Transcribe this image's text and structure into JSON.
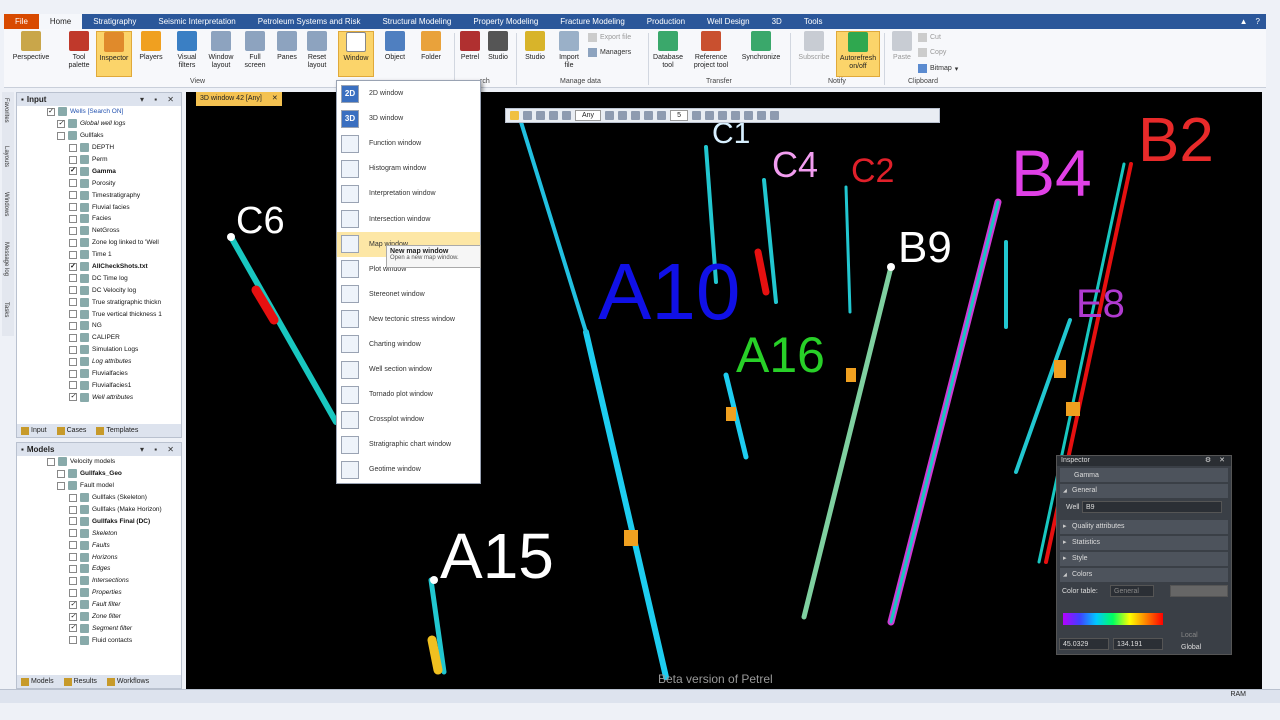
{
  "menu": {
    "file": "File",
    "tabs": [
      "Home",
      "Stratigraphy",
      "Seismic Interpretation",
      "Petroleum Systems and Risk",
      "Structural Modeling",
      "Property Modeling",
      "Fracture Modeling",
      "Production",
      "Well Design",
      "3D",
      "Tools"
    ]
  },
  "ribbon": {
    "perspective": "Perspective",
    "tool_palette": "Tool palette",
    "inspector": "Inspector",
    "players": "Players",
    "visual_filters": "Visual filters",
    "window_layout": "Window layout",
    "full_screen": "Full screen",
    "panes": "Panes",
    "reset_layout": "Reset layout",
    "window": "Window",
    "object": "Object",
    "folder": "Folder",
    "petrel": "Petrel",
    "studio_search": "Studio",
    "studio": "Studio",
    "import_file": "Import file",
    "export_file": "Export file",
    "managers": "Managers",
    "database_tool": "Database tool",
    "reference_project_tool": "Reference project tool",
    "synchronize": "Synchronize",
    "subscribe": "Subscribe",
    "autorefresh": "Autorefresh on/off",
    "paste": "Paste",
    "cut": "Cut",
    "copy": "Copy",
    "bitmap": "Bitmap",
    "group_view": "View",
    "group_search": "rch",
    "group_manage": "Manage data",
    "group_transfer": "Transfer",
    "group_notify": "Notify",
    "group_clipboard": "Clipboard"
  },
  "side_strip": [
    "Favorites",
    "Layouts",
    "Windows",
    "Message log",
    "Tasks"
  ],
  "input_panel": {
    "title": "Input",
    "items": [
      {
        "label": "Wells [Search ON]",
        "style": "sel",
        "check": "✓"
      },
      {
        "label": "Global well logs",
        "style": "i",
        "check": "✓"
      },
      {
        "label": "Gullfaks",
        "style": "",
        "check": ""
      },
      {
        "label": "DEPTH",
        "style": "",
        "check": ""
      },
      {
        "label": "Perm",
        "style": "",
        "check": ""
      },
      {
        "label": "Gamma",
        "style": "b",
        "check": "✓"
      },
      {
        "label": "Porosity",
        "style": "",
        "check": ""
      },
      {
        "label": "Timestratigraphy",
        "style": "",
        "check": ""
      },
      {
        "label": "Fluvial facies",
        "style": "",
        "check": ""
      },
      {
        "label": "Facies",
        "style": "",
        "check": ""
      },
      {
        "label": "NetGross",
        "style": "",
        "check": ""
      },
      {
        "label": "Zone log linked to 'Well",
        "style": "",
        "check": ""
      },
      {
        "label": "Time 1",
        "style": "",
        "check": ""
      },
      {
        "label": "AllCheckShots.txt",
        "style": "b",
        "check": "✓"
      },
      {
        "label": "DC Time log",
        "style": "",
        "check": ""
      },
      {
        "label": "DC Velocity log",
        "style": "",
        "check": ""
      },
      {
        "label": "True stratigraphic thickn",
        "style": "",
        "check": ""
      },
      {
        "label": "True vertical thickness 1",
        "style": "",
        "check": ""
      },
      {
        "label": "NG",
        "style": "",
        "check": ""
      },
      {
        "label": "CALIPER",
        "style": "",
        "check": ""
      },
      {
        "label": "Simulation Logs",
        "style": "",
        "check": ""
      },
      {
        "label": "Log attributes",
        "style": "i",
        "check": ""
      },
      {
        "label": "Fluvialfacies",
        "style": "",
        "check": ""
      },
      {
        "label": "Fluvialfacies1",
        "style": "",
        "check": ""
      },
      {
        "label": "Well attributes",
        "style": "i",
        "check": "✓"
      }
    ],
    "tabs": [
      "Input",
      "Cases",
      "Templates"
    ]
  },
  "models_panel": {
    "title": "Models",
    "items": [
      {
        "label": "Velocity models",
        "style": "",
        "check": ""
      },
      {
        "label": "Gullfaks_Geo",
        "style": "b",
        "check": ""
      },
      {
        "label": "Fault model",
        "style": "",
        "check": ""
      },
      {
        "label": "Gullfaks (Skeleton)",
        "style": "",
        "check": ""
      },
      {
        "label": "Gullfaks (Make Horizon)",
        "style": "",
        "check": ""
      },
      {
        "label": "Gullfaks Final (DC)",
        "style": "b",
        "check": ""
      },
      {
        "label": "Skeleton",
        "style": "i",
        "check": ""
      },
      {
        "label": "Faults",
        "style": "i",
        "check": ""
      },
      {
        "label": "Horizons",
        "style": "i",
        "check": ""
      },
      {
        "label": "Edges",
        "style": "i",
        "check": ""
      },
      {
        "label": "Intersections",
        "style": "i",
        "check": ""
      },
      {
        "label": "Properties",
        "style": "i",
        "check": ""
      },
      {
        "label": "Fault filter",
        "style": "i",
        "check": "✓"
      },
      {
        "label": "Zone filter",
        "style": "i",
        "check": "✓"
      },
      {
        "label": "Segment filter",
        "style": "i",
        "check": "✓"
      },
      {
        "label": "Fluid contacts",
        "style": "",
        "check": ""
      }
    ],
    "tabs": [
      "Models",
      "Results",
      "Workflows"
    ]
  },
  "viewport": {
    "tab_label": "3D window 42 [Any]",
    "toolbar_select": "Any",
    "toolbar_number": "5",
    "watermark": "Beta version of Petrel",
    "well_labels": [
      "C1",
      "C4",
      "C2",
      "B2",
      "B4",
      "C6",
      "B9",
      "A10",
      "A16",
      "E8",
      "A15"
    ]
  },
  "dropdown": {
    "items": [
      {
        "label": "2D window",
        "badge": "2D"
      },
      {
        "label": "3D window",
        "badge": "3D"
      },
      {
        "label": "Function window",
        "badge": ""
      },
      {
        "label": "Histogram window",
        "badge": ""
      },
      {
        "label": "Interpretation window",
        "badge": ""
      },
      {
        "label": "Intersection window",
        "badge": ""
      },
      {
        "label": "Map window",
        "badge": ""
      },
      {
        "label": "Plot window",
        "badge": ""
      },
      {
        "label": "Stereonet window",
        "badge": ""
      },
      {
        "label": "New tectonic stress window",
        "badge": ""
      },
      {
        "label": "Charting window",
        "badge": ""
      },
      {
        "label": "Well section window",
        "badge": ""
      },
      {
        "label": "Tornado plot window",
        "badge": ""
      },
      {
        "label": "Crossplot window",
        "badge": ""
      },
      {
        "label": "Stratigraphic chart window",
        "badge": ""
      },
      {
        "label": "Geotime window",
        "badge": ""
      }
    ],
    "tooltip_title": "New map window",
    "tooltip_text": "Open a new map window."
  },
  "inspector": {
    "title": "Inspector",
    "object": "Gamma",
    "general": "General",
    "well_label": "Well",
    "well_value": "B9",
    "quality": "Quality attributes",
    "statistics": "Statistics",
    "style": "Style",
    "colors": "Colors",
    "color_table": "Color table:",
    "color_table_value": "General",
    "min": "45.0329",
    "max": "134.191",
    "local": "Local",
    "global": "Global"
  },
  "status": {
    "ram": "RAM"
  },
  "colors": {
    "menubar": "#2b579a",
    "file": "#d84a00",
    "highlight": "#fbd46a"
  }
}
